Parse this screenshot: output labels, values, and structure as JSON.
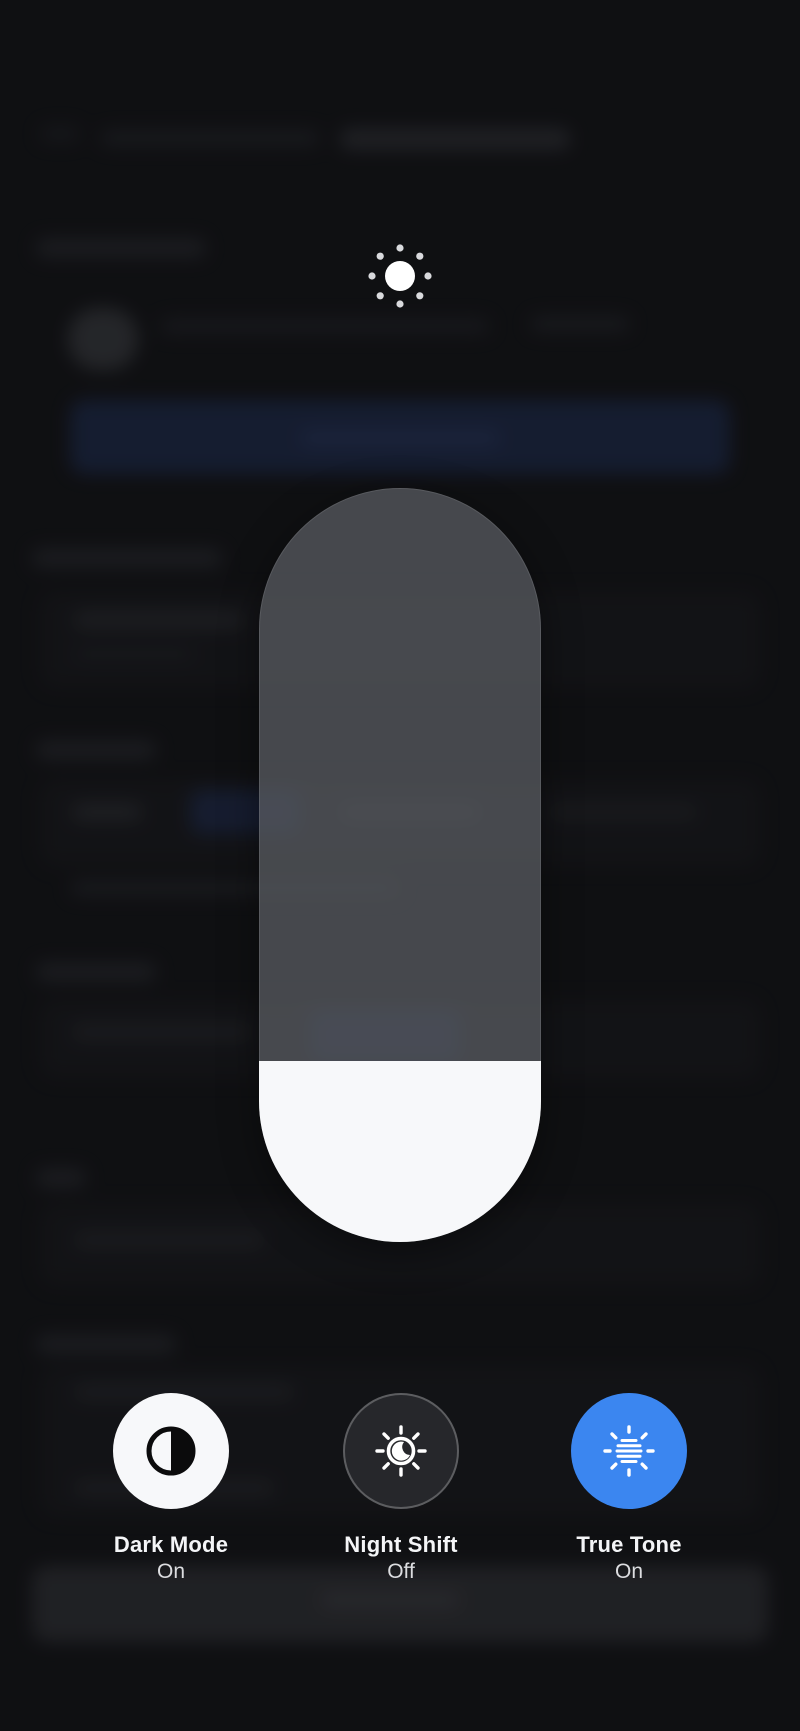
{
  "brightness": {
    "icon": "sun-icon",
    "level": 0.24
  },
  "toggles": [
    {
      "id": "dark-mode",
      "label": "Dark Mode",
      "state": "On",
      "icon": "dark-mode-icon",
      "color": "#f7f8fa"
    },
    {
      "id": "night-shift",
      "label": "Night Shift",
      "state": "Off",
      "icon": "night-shift-icon",
      "color": "#26272b"
    },
    {
      "id": "true-tone",
      "label": "True Tone",
      "state": "On",
      "icon": "true-tone-icon",
      "color": "#3b86f0"
    }
  ]
}
